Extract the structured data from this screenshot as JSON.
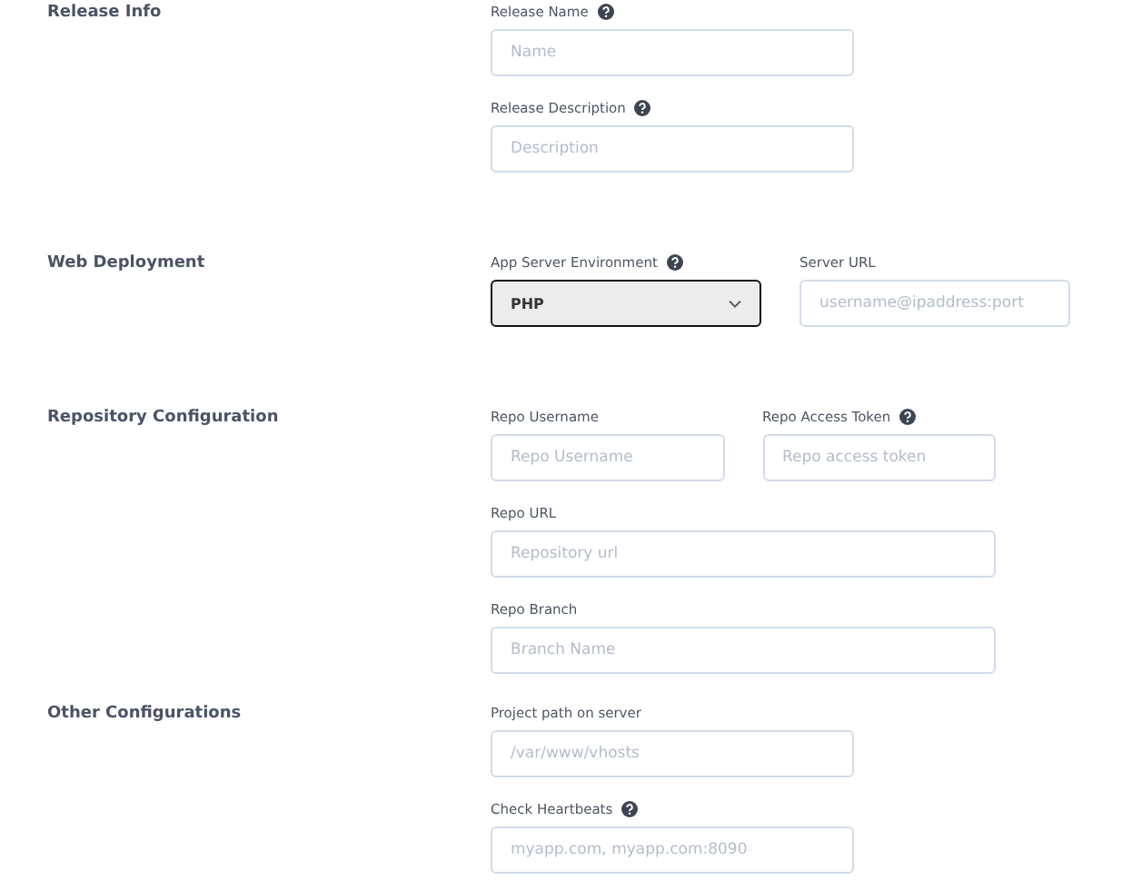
{
  "sections": [
    {
      "title": "Release Info",
      "rows": [
        [
          {
            "kind": "text",
            "label": "Release Name",
            "help": true,
            "placeholder": "Name"
          }
        ],
        [
          {
            "kind": "text",
            "label": "Release Description",
            "help": true,
            "placeholder": "Description"
          }
        ]
      ]
    },
    {
      "title": "Web Deployment",
      "rows": [
        [
          {
            "kind": "select",
            "label": "App Server Environment",
            "help": true,
            "value": "PHP"
          },
          {
            "kind": "text",
            "label": "Server URL",
            "help": false,
            "placeholder": "username@ipaddress:port"
          }
        ]
      ]
    },
    {
      "title": "Repository Configuration",
      "rows": [
        [
          {
            "kind": "text",
            "label": "Repo Username",
            "help": false,
            "placeholder": "Repo Username"
          },
          {
            "kind": "text",
            "label": "Repo Access Token",
            "help": true,
            "placeholder": "Repo access token"
          }
        ],
        [
          {
            "kind": "text",
            "label": "Repo URL",
            "help": false,
            "placeholder": "Repository url"
          }
        ],
        [
          {
            "kind": "text",
            "label": "Repo Branch",
            "help": false,
            "placeholder": "Branch Name"
          }
        ]
      ]
    },
    {
      "title": "Other Configurations",
      "rows": [
        [
          {
            "kind": "text",
            "label": "Project path on server",
            "help": false,
            "placeholder": "/var/www/vhosts"
          }
        ],
        [
          {
            "kind": "text",
            "label": "Check Heartbeats",
            "help": true,
            "placeholder": "myapp.com, myapp.com:8090"
          }
        ]
      ]
    }
  ]
}
